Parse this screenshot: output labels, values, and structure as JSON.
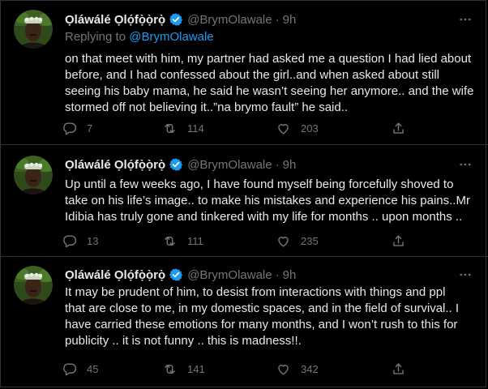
{
  "colors": {
    "background": "#000000",
    "text": "#e7e9ea",
    "muted": "#71767b",
    "link": "#1d9bf0",
    "verified": "#1d9bf0",
    "divider": "#2f3336"
  },
  "tweets": [
    {
      "author_name": "Ọláwálé Ọlọ́fọ̀ọ̀rọ̀",
      "handle": "@BrymOlawale",
      "time": "9h",
      "replying_prefix": "Replying to ",
      "replying_to": "@BrymOlawale",
      "text_lines": [
        "on that meet with him, my partner had asked me a question I had lied about",
        "before, and I had confessed about the girl..and when asked about still",
        "seeing his baby mama, he said he wasn’t seeing her anymore.. and the wife",
        "stormed off not believing it..”na brymo fault” he said.."
      ],
      "replies": "7",
      "retweets": "114",
      "likes": "203"
    },
    {
      "author_name": "Ọláwálé Ọlọ́fọ̀ọ̀rọ̀",
      "handle": "@BrymOlawale",
      "time": "9h",
      "text_lines": [
        "Up until a few weeks ago, I have found myself being forcefully shoved to",
        "take on his life’s image.. to make his mistakes and experience his pains..Mr",
        "Idibia has truly gone and tinkered with my life for months .. upon months .."
      ],
      "replies": "13",
      "retweets": "111",
      "likes": "235"
    },
    {
      "author_name": "Ọláwálé Ọlọ́fọ̀ọ̀rọ̀",
      "handle": "@BrymOlawale",
      "time": "9h",
      "text_lines": [
        "It may be prudent of him, to desist from interactions with things and ppl",
        "that are close to me, in my domestic spaces, and in the field of survival.. I",
        "have carried these emotions for many months, and I won’t rush to this for",
        "publicity .. it is not funny .. this is madness!!."
      ],
      "replies": "45",
      "retweets": "141",
      "likes": "342"
    }
  ],
  "icons": {
    "verified": "verified-badge-icon",
    "more": "more-horizontal-icon",
    "reply": "reply-bubble-icon",
    "retweet": "retweet-icon",
    "like": "heart-icon",
    "share": "share-upload-icon"
  }
}
